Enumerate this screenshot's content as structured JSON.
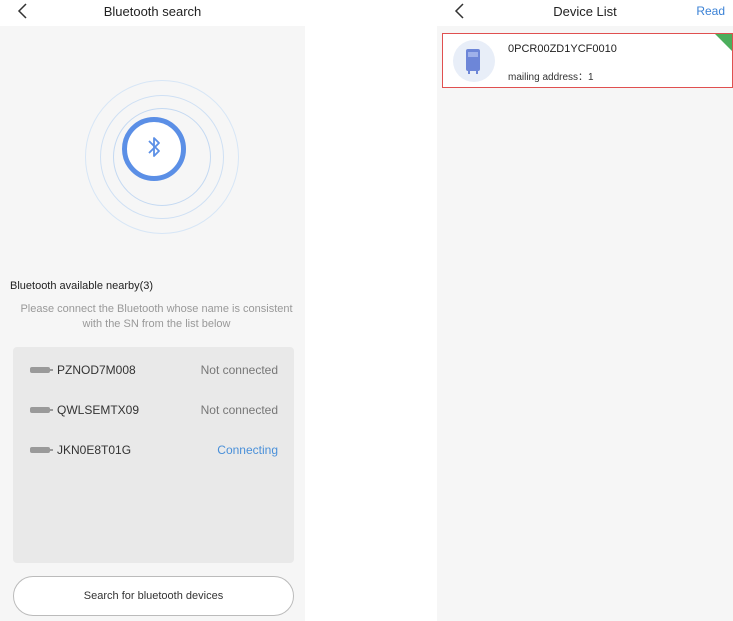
{
  "left_screen": {
    "title": "Bluetooth search",
    "nearby_title": "Bluetooth available nearby(3)",
    "hint_line1": "Please connect the Bluetooth whose name is consistent",
    "hint_line2": "with the SN from the list below",
    "devices": [
      {
        "name": "PZNOD7M008",
        "status": "Not connected"
      },
      {
        "name": "QWLSEMTX09",
        "status": "Not connected"
      },
      {
        "name": "JKN0E8T01G",
        "status": "Connecting"
      }
    ],
    "search_button": "Search for bluetooth devices"
  },
  "right_screen": {
    "title": "Device List",
    "read_label": "Read",
    "items": [
      {
        "name": "0PCR00ZD1YCF0010",
        "address": "mailing address：1"
      }
    ]
  },
  "colors": {
    "accent": "#5b8fe6",
    "connecting": "#4a90d9",
    "selected_border": "#e05050",
    "corner_tag": "#4cae5c"
  },
  "icons": [
    "back-icon",
    "bluetooth-icon",
    "device-icon",
    "inverter-icon"
  ]
}
